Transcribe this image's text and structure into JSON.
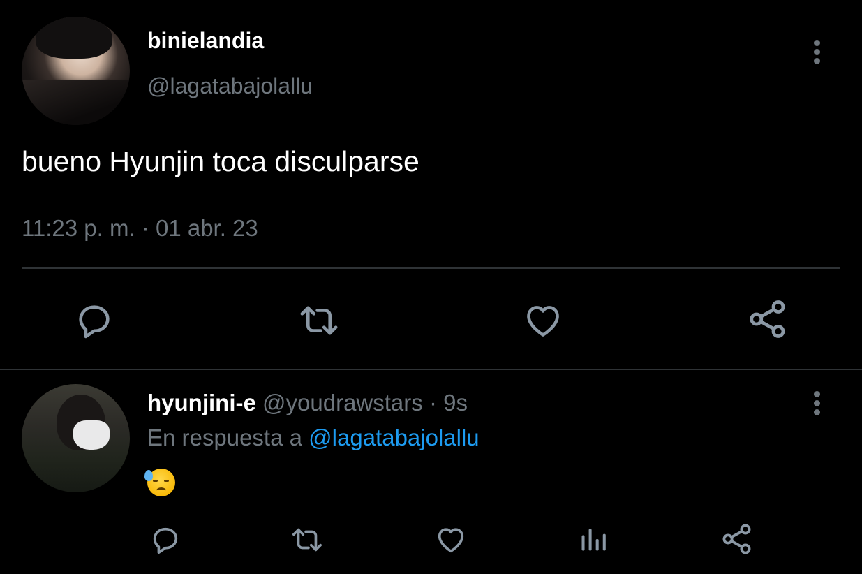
{
  "main_tweet": {
    "display_name": "binielandia",
    "handle": "@lagatabajolallu",
    "text": "bueno Hyunjin toca disculparse",
    "timestamp": "11:23 p. m. · 01 abr. 23",
    "actions": [
      "reply-icon",
      "retweet-icon",
      "like-icon",
      "share-icon"
    ]
  },
  "reply_tweet": {
    "display_name": "hyunjini-e",
    "handle": "@youdrawstars",
    "separator": "·",
    "time": "9s",
    "reply_prefix": "En respuesta a ",
    "reply_to": "@lagatabajolallu",
    "content_emoji": "downcast-face-with-sweat",
    "actions": [
      "reply-icon",
      "retweet-icon",
      "like-icon",
      "analytics-icon",
      "share-icon"
    ]
  },
  "colors": {
    "background": "#000000",
    "text_primary": "#ffffff",
    "text_secondary": "#6e767d",
    "link": "#1d9bf0",
    "divider": "#2f3336",
    "icon": "#8b98a5"
  }
}
